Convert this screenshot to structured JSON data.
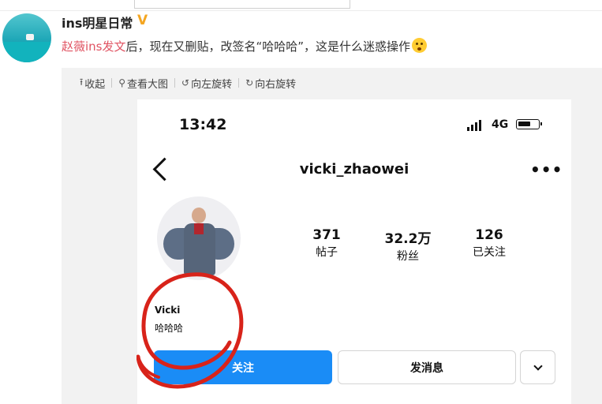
{
  "post": {
    "username": "ins明星日常",
    "verified_badge": "V",
    "mention": "赵薇ins发文",
    "text": "后，现在又删贴，改签名“哈哈哈”，这是什么迷惑操作"
  },
  "toolbar": {
    "collapse": "收起",
    "view_large": "查看大图",
    "rotate_left": "向左旋转",
    "rotate_right": "向右旋转"
  },
  "phone": {
    "status_time": "13:42",
    "network": "4G",
    "profile_username": "vicki_zhaowei",
    "stats": [
      {
        "value": "371",
        "label": "帖子"
      },
      {
        "value": "32.2万",
        "label": "粉丝"
      },
      {
        "value": "126",
        "label": "已关注"
      }
    ],
    "bio_name": "Vicki",
    "bio_text": "哈哈哈",
    "follow_button": "关注",
    "message_button": "发消息"
  },
  "colors": {
    "mention": "#e05463",
    "follow_blue": "#1a8cf6",
    "annotation_red": "#d8231a",
    "verified": "#f4a622"
  }
}
